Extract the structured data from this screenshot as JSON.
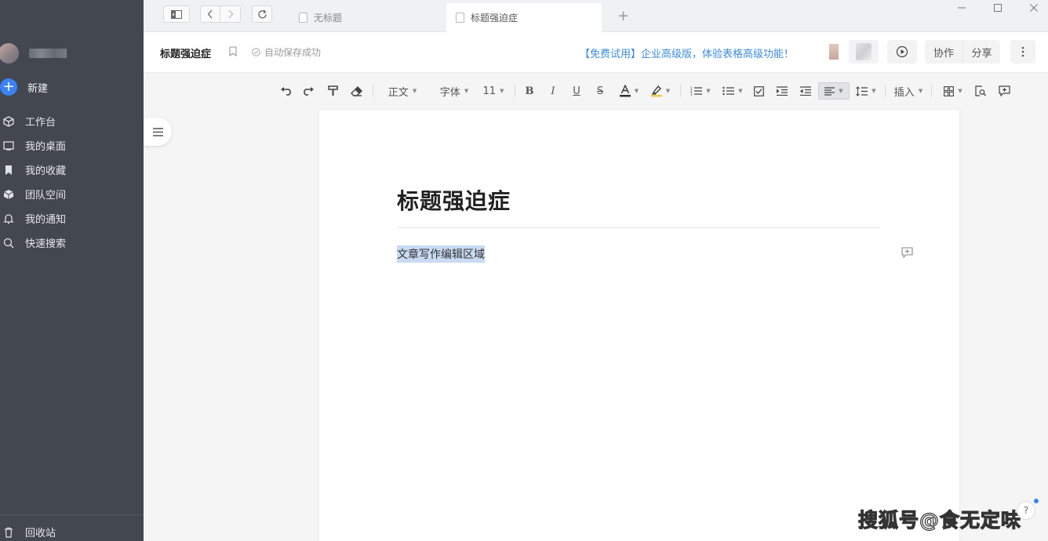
{
  "sidebar": {
    "new_label": "新建",
    "items": [
      {
        "label": "工作台",
        "icon": "cube-icon"
      },
      {
        "label": "我的桌面",
        "icon": "desktop-icon"
      },
      {
        "label": "我的收藏",
        "icon": "bookmark-icon"
      },
      {
        "label": "团队空间",
        "icon": "box-icon"
      },
      {
        "label": "我的通知",
        "icon": "bell-icon"
      },
      {
        "label": "快速搜索",
        "icon": "search-icon"
      }
    ],
    "trash_label": "回收站"
  },
  "tabs": [
    {
      "label": "无标题",
      "active": false
    },
    {
      "label": "标题强迫症",
      "active": true
    }
  ],
  "header": {
    "doc_title": "标题强迫症",
    "save_status": "自动保存成功",
    "promo": "【免费试用】企业高级版，体验表格高级功能！",
    "collab_label": "协作",
    "share_label": "分享"
  },
  "toolbar": {
    "style_label": "正文",
    "font_label": "字体",
    "size_label": "11",
    "insert_label": "插入"
  },
  "document": {
    "title": "标题强迫症",
    "body": "文章写作编辑区域"
  },
  "watermark": "搜狐号@食无定味",
  "colors": {
    "sidebar_bg": "#424750",
    "accent": "#3b82f6",
    "promo": "#3d8bd9",
    "selection": "#c9dbf3"
  }
}
